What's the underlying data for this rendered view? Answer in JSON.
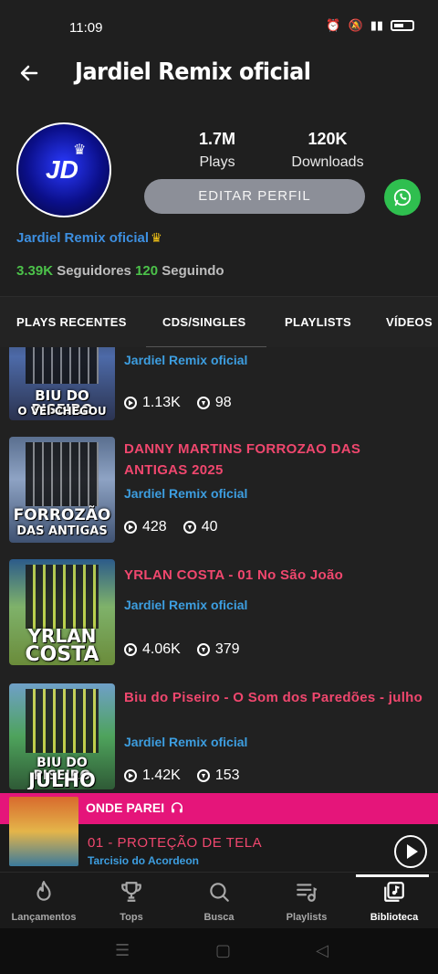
{
  "status": {
    "time": "11:09"
  },
  "header": {
    "title": "Jardiel Remix oficial"
  },
  "profile": {
    "avatar_text": "JD",
    "plays_value": "1.7M",
    "plays_label": "Plays",
    "downloads_value": "120K",
    "downloads_label": "Downloads",
    "edit_label": "EDITAR PERFIL",
    "name": "Jardiel Remix oficial",
    "followers_value": "3.39K",
    "followers_label": "Seguidores",
    "following_value": "120",
    "following_label": "Seguindo"
  },
  "tabs": [
    {
      "label": "PLAYS RECENTES"
    },
    {
      "label": "CDS/SINGLES"
    },
    {
      "label": "PLAYLISTS"
    },
    {
      "label": "VÍDEOS"
    }
  ],
  "tracks": [
    {
      "cover_line1": "BIU DO PISEIRO",
      "cover_line2": "O VEI CHEGOU",
      "title": "",
      "artist": "Jardiel Remix oficial",
      "plays": "1.13K",
      "downloads": "98"
    },
    {
      "cover_line1": "FORROZÃO",
      "cover_line2": "DAS ANTIGAS",
      "title": "DANNY MARTINS FORROZAO DAS ANTIGAS 2025",
      "artist": "Jardiel Remix oficial",
      "plays": "428",
      "downloads": "40"
    },
    {
      "cover_line1": "YRLAN",
      "cover_line2": "COSTA",
      "title": "YRLAN COSTA - 01 No São João",
      "artist": "Jardiel Remix oficial",
      "plays": "4.06K",
      "downloads": "379"
    },
    {
      "cover_line1": "BIU DO PISEIRO",
      "cover_line2": "JULHO",
      "title": "Biu do Piseiro - O Som dos Paredões - julho",
      "artist": "Jardiel Remix oficial",
      "plays": "1.42K",
      "downloads": "153"
    }
  ],
  "now_playing": {
    "label": "ONDE PAREI",
    "title": "01 - PROTEÇÃO DE TELA",
    "artist": "Tarcisio do Acordeon"
  },
  "nav": [
    {
      "label": "Lançamentos",
      "icon": "flame-icon"
    },
    {
      "label": "Tops",
      "icon": "trophy-icon"
    },
    {
      "label": "Busca",
      "icon": "search-icon"
    },
    {
      "label": "Playlists",
      "icon": "playlist-icon"
    },
    {
      "label": "Biblioteca",
      "icon": "library-icon"
    }
  ],
  "colors": {
    "accent_pink": "#e5157a",
    "title_pink": "#f0476e",
    "link_blue": "#3d9ee0",
    "green": "#4cc24a"
  }
}
